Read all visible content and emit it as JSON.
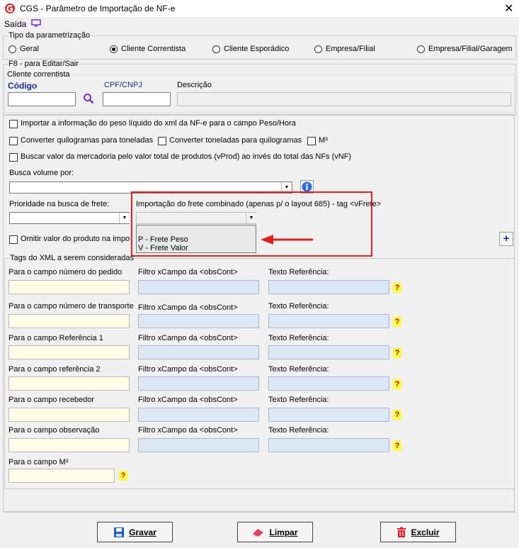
{
  "window": {
    "title": "CGS - Parâmetro de Importação de NF-e",
    "close": "✕"
  },
  "menu": {
    "saida": "Saída"
  },
  "tipo": {
    "legend": "Tipo da parametrização",
    "options": [
      "Geral",
      "Cliente Correntista",
      "Cliente Esporádico",
      "Empresa/Filial",
      "Empresa/Filial/Garagem"
    ],
    "selected": "Cliente Correntista"
  },
  "f8": {
    "legend": "F8 - para Editar/Sair"
  },
  "cliente": {
    "legend": "Cliente correntista",
    "codigo_label": "Código",
    "cpf_label": "CPF/CNPJ",
    "descricao_label": "Descrição",
    "codigo": "",
    "cpf": "",
    "descricao": ""
  },
  "options": {
    "peso_liquido": "Importar a informação do peso líquido do xml da NF-e para o campo Peso/Hora",
    "kg_to_ton": "Converter quilogramas para toneladas",
    "ton_to_kg": "Converter toneladas para quilogramas",
    "m3": "M³",
    "vprod": "Buscar valor da mercadoria pelo valor total de produtos (vProd) ao invés do total das NFs (vNF)",
    "busca_volume_label": "Busca volume por:",
    "prioridade_label": "Prioridade na busca de frete:",
    "frete_combinado_label": "Importação do frete combinado (apenas p/ o layout 685) - tag <vFrete>",
    "frete_options": [
      "P - Frete Peso",
      "V - Frete Valor"
    ],
    "omitir": "Omitir valor do produto na importação"
  },
  "tags": {
    "legend": "Tags do XML a serem consideradas",
    "filtro_label": "Filtro xCampo da <obsCont>",
    "texto_label": "Texto Referência:",
    "rows": [
      {
        "label": "Para o campo número do pedido"
      },
      {
        "label": "Para o campo número de transporte"
      },
      {
        "label": "Para o campo Referência 1"
      },
      {
        "label": "Para o campo referência 2"
      },
      {
        "label": "Para o campo recebedor"
      },
      {
        "label": "Para o campo observação"
      }
    ],
    "m3_label": "Para o campo M³"
  },
  "buttons": {
    "gravar": "Gravar",
    "limpar": "Limpar",
    "excluir": "Excluir"
  },
  "colors": {
    "highlight": "#e02020",
    "input_blue": "#dde8f5",
    "input_yellow": "#fffde8"
  }
}
